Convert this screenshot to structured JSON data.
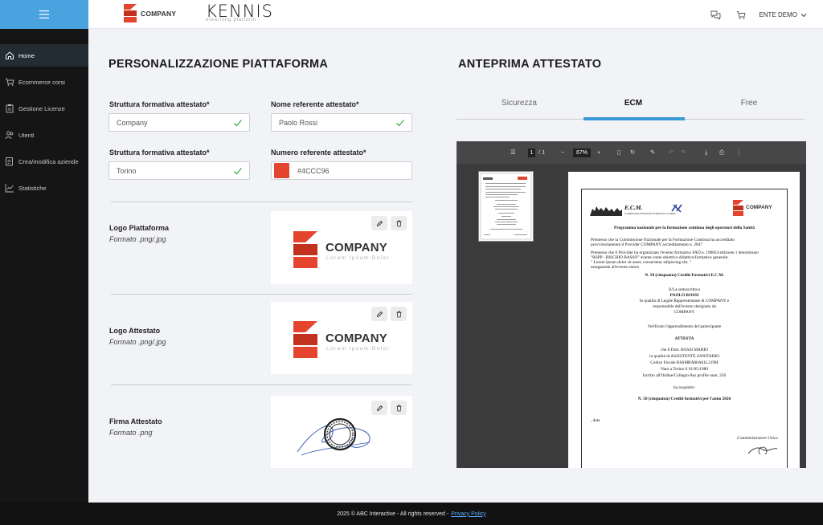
{
  "sidebar": {
    "items": [
      {
        "label": "Home",
        "icon": "home-icon"
      },
      {
        "label": "Ecommerce corsi",
        "icon": "cart-icon"
      },
      {
        "label": "Gestione Licenze",
        "icon": "clipboard-icon"
      },
      {
        "label": "Utenti",
        "icon": "users-icon"
      },
      {
        "label": "Crea/modifica aziende",
        "icon": "edit-document-icon"
      },
      {
        "label": "Statistiche",
        "icon": "chart-icon"
      }
    ],
    "accent": "#4aa3df"
  },
  "header": {
    "company_logo_text": "COMPANY",
    "platform_logo": "KENNIS",
    "platform_sub": "elearning platform",
    "user_label": "ENTE DEMO"
  },
  "settings": {
    "title": "PERSONALIZZAZIONE PIATTAFORMA",
    "fields": [
      {
        "label": "Struttura formativa attestato*",
        "value": "Company"
      },
      {
        "label": "Nome referente attestato*",
        "value": "Paolo Rossi"
      },
      {
        "label": "Struttura formativa attestato*",
        "value": "Torino"
      },
      {
        "label": "Numero referente attestato*",
        "value": "#4CCC96",
        "swatch": "#e5452f"
      }
    ],
    "assets": [
      {
        "title": "Logo Piattaforma",
        "format": "Formato .png/.jpg",
        "company": "COMPANY",
        "tagline": "Lorem Ipsum Dolor"
      },
      {
        "title": "Logo Attestato",
        "format": "Formato .png/.jpg",
        "company": "COMPANY",
        "tagline": "Lorem Ipsum Dolor"
      },
      {
        "title": "Firma Attestato",
        "format": "Formato .png"
      }
    ]
  },
  "preview": {
    "title": "ANTEPRIMA ATTESTATO",
    "tabs": [
      "Sicurezza",
      "ECM",
      "Free"
    ],
    "active_tab": "ECM",
    "viewer": {
      "page": "1",
      "pages": "/ 1",
      "zoom": "67%"
    },
    "certificate": {
      "ecm_title": "E.C.M.",
      "ecm_sub": "Commissione Nazionale Formazione Continua",
      "company": "COMPANY",
      "heading": "Programma nazionale per la formazione continua degli operatori della Sanità",
      "lines": [
        "Premesso che la Commissione Nazionale per la Formazione Continua ha accreditato",
        "provvisoriamente il Provider COMPANY accreditamento n. 2847",
        "Premesso che il Provider ha organizzato l'evento formativo FAD n. 190824 edizione 1 denominato",
        "\"RSPP - RISCHIO BASSO\" avente come obiettivo didattico/formativo generale:",
        "\" Lorem ipsum dolor sit amet, consectetur adipiscing elit. \"",
        "assegnando all'evento stesso"
      ],
      "credits": "N. 50 (cinquanta) Crediti Formativi E.C.M.",
      "signer_intro": "Il/La sottoscritto/a",
      "signer": "PAOLO ROSSI",
      "signer_role_1": "In qualità di Legale Rappresentante di COMPANY e",
      "signer_role_2": "responsabile dell'evento designato da",
      "signer_company": "COMPANY",
      "verified": "Verificato l'apprendimento del partecipante",
      "attesta": "ATTESTA",
      "p1": "che il Dott. ROSSI MARIO",
      "p2": "in qualità di ASSISTENTE SANITARIO",
      "p3": "Codice Fiscale RSSMRA80A01L219M",
      "p4": "Nato a Torino il 01/05/1980",
      "p5": "Iscritto all'Ordine/Collegio/Ass profile num. 256",
      "acquired": "ha acquisito:",
      "credits_year": "N. 50 (cinquanta) Crediti formativi per l'anno 2026",
      "date": ", data",
      "admin": "L'amministratore Unico"
    }
  },
  "footer": {
    "text": "2025 © ABC Interactive - All rights reserved -",
    "link": "Privacy Policy"
  }
}
